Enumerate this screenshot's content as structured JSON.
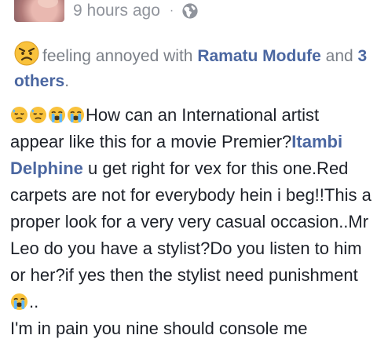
{
  "post": {
    "time_label": "9 hours ago",
    "separator": "·",
    "privacy_icon": "globe-icon",
    "feeling": {
      "icon": "angry-face-icon",
      "prefix": "feeling annoyed with ",
      "tagged_name": "Ramatu Modufe",
      "and_text": "and ",
      "others_count": "3 others",
      "period": "."
    },
    "body": {
      "leading_emojis": [
        "downcast-sweat-face-icon",
        "downcast-sweat-face-icon",
        "loudly-crying-face-icon",
        "loudly-crying-face-icon"
      ],
      "text_1": "How can an International artist appear like this for a movie Premier?",
      "mention": "Itambi Delphine",
      "text_2": " u get right for vex for this one.Red carpets are not for everybody hein i beg!!This a proper look for a very very casual occasion..Mr Leo do you have a stylist?Do you listen to him or her?if yes then the stylist need punishment",
      "trailing_emoji": "loudly-crying-face-icon",
      "text_3": "..",
      "text_4": "I'm in pain you nine should console me"
    }
  }
}
